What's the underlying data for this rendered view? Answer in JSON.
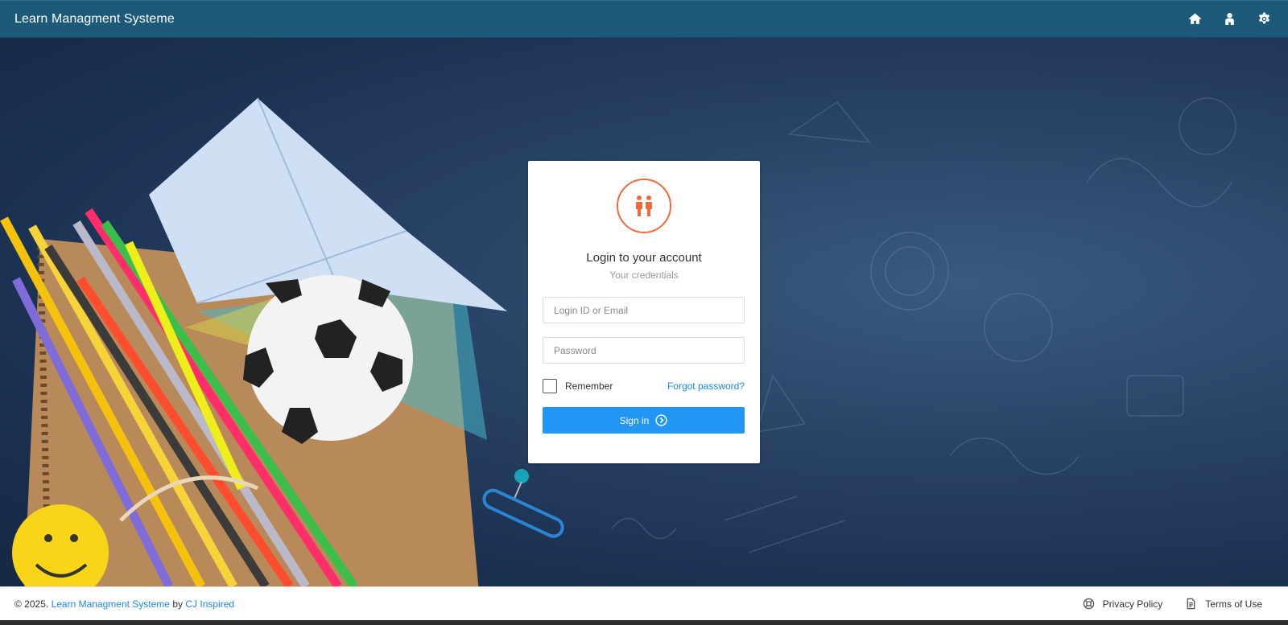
{
  "navbar": {
    "brand": "Learn Managment Systeme",
    "icons": [
      "home-icon",
      "user-icon",
      "settings-icon"
    ]
  },
  "login": {
    "title": "Login to your account",
    "subtitle": "Your credentials",
    "login_placeholder": "Login ID or Email",
    "password_placeholder": "Password",
    "remember_label": "Remember",
    "forgot_label": "Forgot password?",
    "signin_label": "Sign in",
    "accent_color": "#ee6a3a",
    "button_color": "#2196f3"
  },
  "footer": {
    "copyright": "© 2025.",
    "app_link": "Learn Managment Systeme",
    "by": "by",
    "author_link": "CJ Inspired",
    "privacy": "Privacy Policy",
    "terms": "Terms of Use"
  }
}
